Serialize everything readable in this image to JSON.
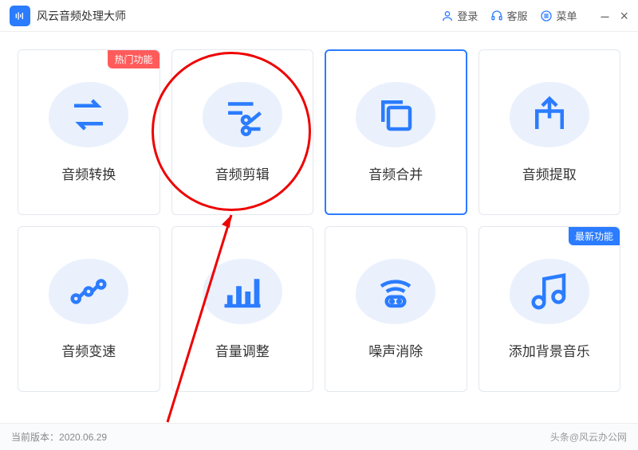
{
  "app_title": "风云音频处理大师",
  "titlebar": {
    "login": "登录",
    "support": "客服",
    "menu": "菜单"
  },
  "badges": {
    "hot": "热门功能",
    "new": "最新功能"
  },
  "cards": [
    {
      "id": "convert",
      "label": "音频转换",
      "badge": "hot",
      "selected": false
    },
    {
      "id": "edit",
      "label": "音频剪辑",
      "badge": null,
      "selected": false
    },
    {
      "id": "merge",
      "label": "音频合并",
      "badge": null,
      "selected": true
    },
    {
      "id": "extract",
      "label": "音频提取",
      "badge": null,
      "selected": false
    },
    {
      "id": "speed",
      "label": "音频变速",
      "badge": null,
      "selected": false
    },
    {
      "id": "volume",
      "label": "音量调整",
      "badge": null,
      "selected": false
    },
    {
      "id": "denoise",
      "label": "噪声消除",
      "badge": null,
      "selected": false
    },
    {
      "id": "bgm",
      "label": "添加背景音乐",
      "badge": "new",
      "selected": false
    }
  ],
  "footer": {
    "version_label": "当前版本：",
    "version": "2020.06.29"
  },
  "watermark": "头条@风云办公网",
  "colors": {
    "accent": "#2b7cff",
    "hot": "#ff5b5b"
  }
}
